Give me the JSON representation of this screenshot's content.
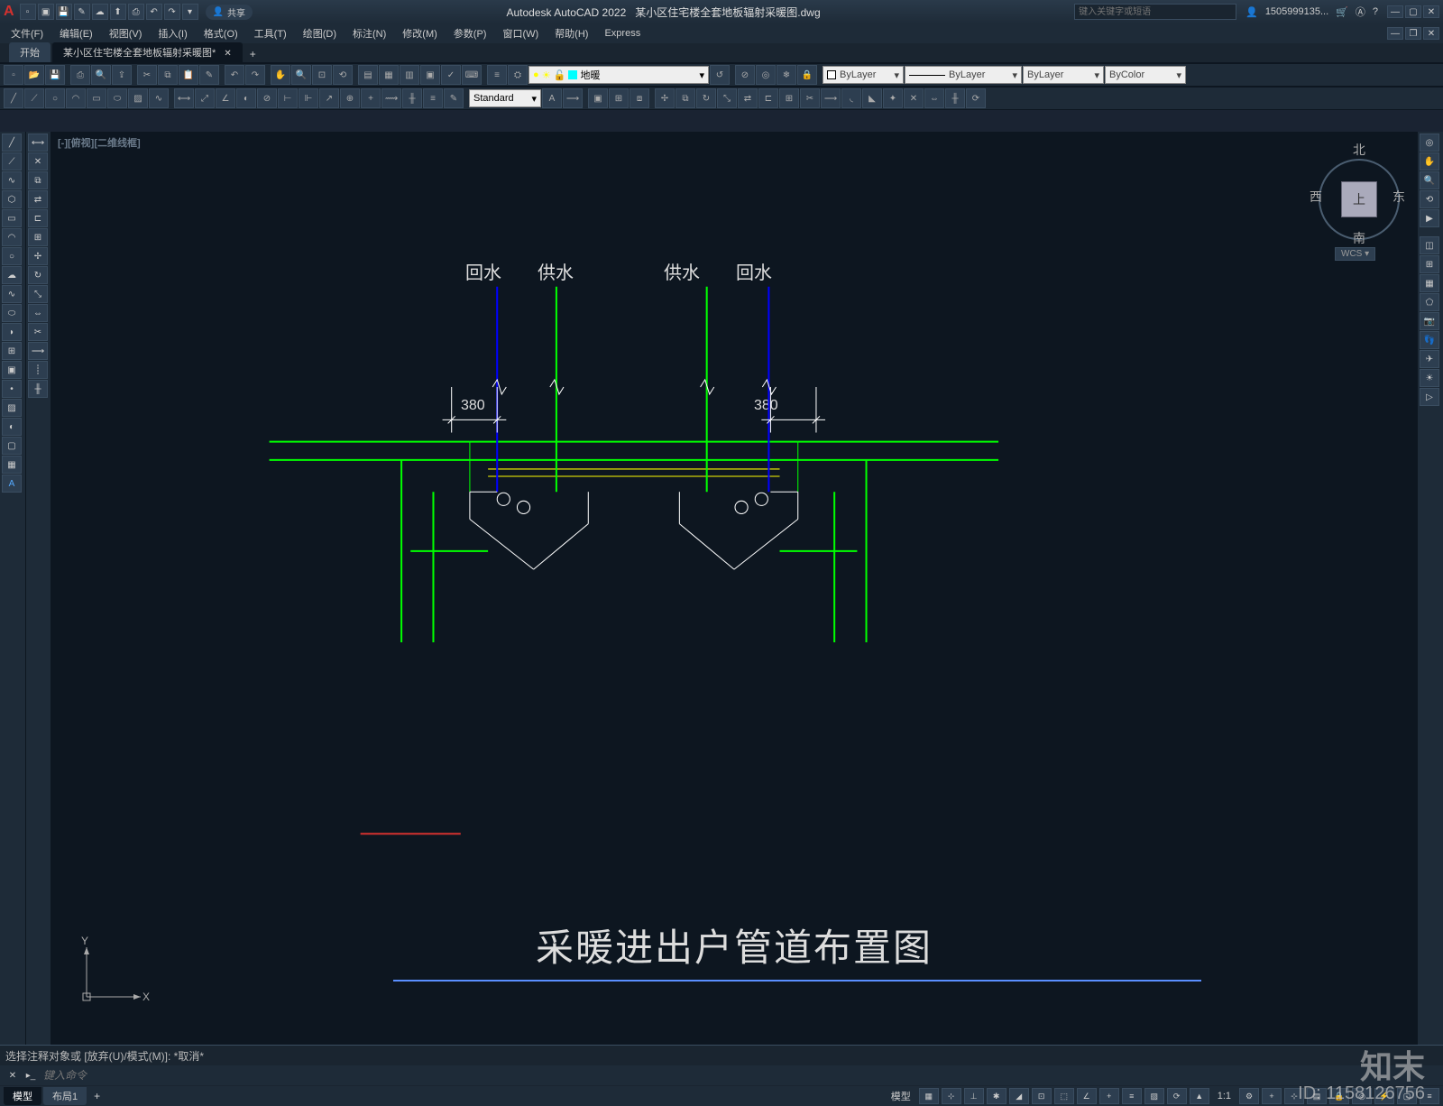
{
  "app": {
    "title": "Autodesk AutoCAD 2022",
    "filename": "某小区住宅楼全套地板辐射采暖图.dwg",
    "logo": "A",
    "share_label": "共享"
  },
  "search": {
    "placeholder": "键入关键字或短语"
  },
  "user": {
    "name": "1505999135..."
  },
  "menubar": {
    "items": [
      {
        "label": "文件(F)"
      },
      {
        "label": "编辑(E)"
      },
      {
        "label": "视图(V)"
      },
      {
        "label": "插入(I)"
      },
      {
        "label": "格式(O)"
      },
      {
        "label": "工具(T)"
      },
      {
        "label": "绘图(D)"
      },
      {
        "label": "标注(N)"
      },
      {
        "label": "修改(M)"
      },
      {
        "label": "参数(P)"
      },
      {
        "label": "窗口(W)"
      },
      {
        "label": "帮助(H)"
      },
      {
        "label": "Express"
      }
    ]
  },
  "doctabs": {
    "start": "开始",
    "file": "某小区住宅楼全套地板辐射采暖图*"
  },
  "layer_panel": {
    "current_layer": "地暖",
    "color_swatch": "#00ffff"
  },
  "properties_panel": {
    "color": "ByLayer",
    "lineweight": "ByLayer",
    "linetype": "ByLayer",
    "plotstyle": "ByColor"
  },
  "textstyle": {
    "current": "Standard"
  },
  "viewport": {
    "label": "[-][俯视][二维线框]"
  },
  "viewcube": {
    "face": "上",
    "north": "北",
    "south": "南",
    "east": "东",
    "west": "西",
    "wcs": "WCS"
  },
  "drawing": {
    "title": "采暖进出户管道布置图",
    "labels": {
      "return_water": "回水",
      "supply_water": "供水"
    },
    "dimensions": {
      "left": "380",
      "right": "380"
    },
    "colors": {
      "supply": "#00ff00",
      "return": "#0000ff",
      "dim": "#ffffff",
      "construction": "#ffff00"
    }
  },
  "ucs": {
    "x": "X",
    "y": "Y"
  },
  "command": {
    "history": "选择注释对象或 [放弃(U)/模式(M)]: *取消*",
    "placeholder": "键入命令"
  },
  "statusbar": {
    "layout_tabs": [
      {
        "label": "模型",
        "active": true
      },
      {
        "label": "布局1",
        "active": false
      }
    ],
    "model_button": "模型",
    "scale": "1:1"
  },
  "watermark": {
    "brand": "知末",
    "id": "ID: 1158126756"
  }
}
